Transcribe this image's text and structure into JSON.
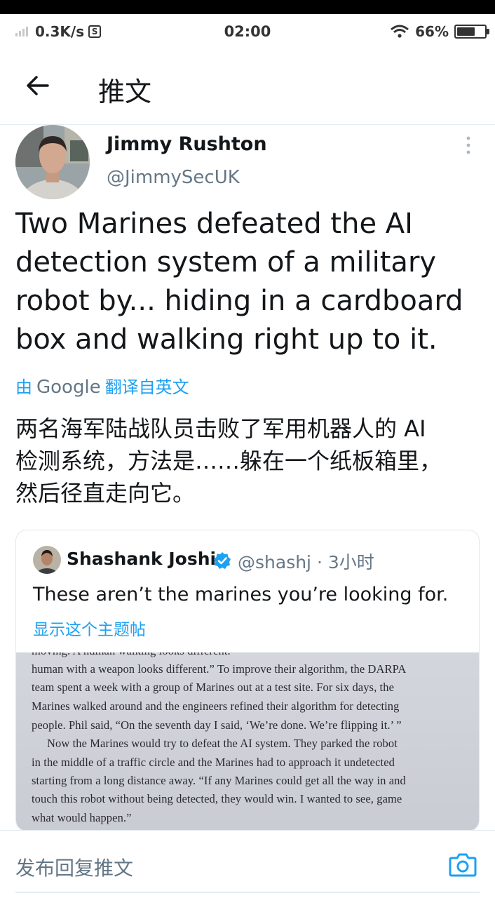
{
  "status_bar": {
    "network_speed": "0.3K/s",
    "sim_icon": "S",
    "time": "02:00",
    "battery_text": "66%",
    "battery_level": 0.66
  },
  "header": {
    "title": "推文",
    "back_icon": "arrow-left-icon"
  },
  "tweet": {
    "author_name": "Jimmy Rushton",
    "author_handle": "@JimmySecUK",
    "lines": [
      "Two Marines defeated the AI",
      "detection system of a military",
      "robot by... hiding in a cardboard",
      "box and walking right up to it."
    ],
    "translate_prefix": "由",
    "translate_brand": "Google",
    "translate_label": "翻译自英文",
    "translated_lines": [
      "两名海军陆战队员击败了军用机器人的 AI",
      "检测系统，方法是……躲在一个纸板箱里，",
      "然后径直走向它。"
    ]
  },
  "quoted_tweet": {
    "author_name": "Shashank Joshi",
    "meta": "@shashj · 3小时",
    "text": "These aren’t the marines you’re looking for.",
    "show_thread": "显示这个主题帖",
    "image_lines": [
      "moving. A human walking looks different.",
      "human with a weapon looks different.” To improve their algorithm, the DARPA",
      "team spent a week with a group of Marines out at a test site. For six days, the",
      "Marines walked around and the engineers refined their algorithm for detecting",
      "people. Phil said, “On the seventh day I said, ‘We’re done. We’re flipping it.’ ”",
      "Now the Marines would try to defeat the AI system. They parked the robot",
      "in the middle of a traffic circle and the Marines had to approach it undetected",
      "starting from a long distance away. “If any Marines could get all the way in and",
      "touch this robot without being detected, they would win. I wanted to see, game",
      "what would happen.”"
    ]
  },
  "reply_bar": {
    "placeholder": "发布回复推文",
    "camera_icon": "camera-icon"
  },
  "colors": {
    "accent": "#1da1f2",
    "secondary_text": "#657786",
    "primary_text": "#14171a"
  }
}
